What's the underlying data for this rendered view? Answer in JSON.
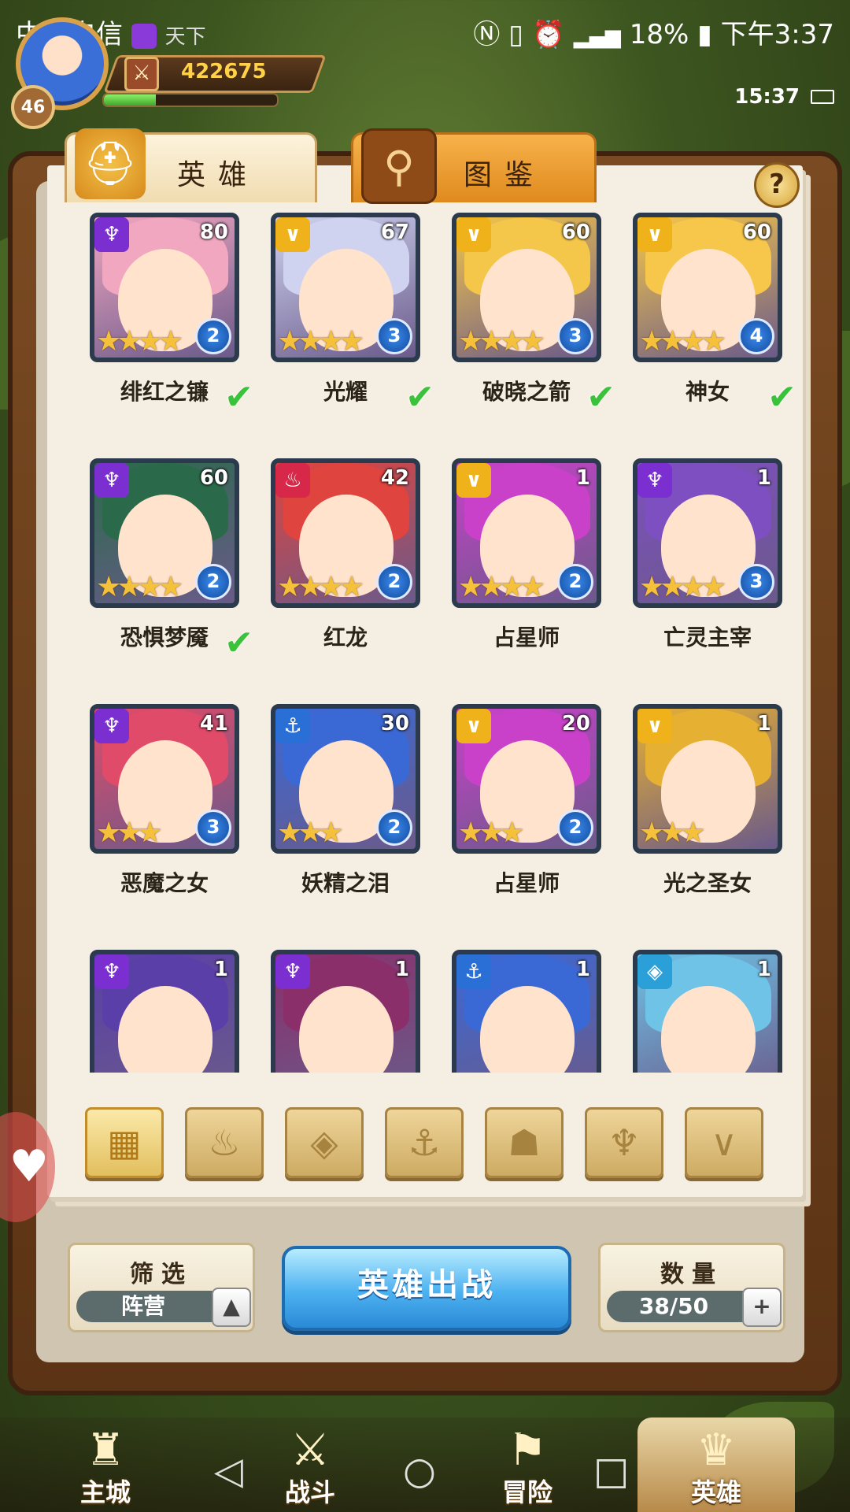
{
  "status_bar": {
    "carrier": "中国电信",
    "notification_text": "天下",
    "battery": "18%",
    "time": "下午3:37"
  },
  "player": {
    "level": "46",
    "power": "422675",
    "xp_fraction": 0.3,
    "game_clock": "15:37"
  },
  "tabs": [
    {
      "label": "英雄",
      "active": true
    },
    {
      "label": "图鉴",
      "active": false
    }
  ],
  "help_label": "?",
  "heroes": [
    {
      "name": "绯红之镰",
      "level": "80",
      "stars": 4,
      "rank": "2",
      "ready": true,
      "faction": "dark"
    },
    {
      "name": "光耀",
      "level": "67",
      "stars": 4,
      "rank": "3",
      "ready": true,
      "faction": "light"
    },
    {
      "name": "破晓之箭",
      "level": "60",
      "stars": 4,
      "rank": "3",
      "ready": true,
      "faction": "light"
    },
    {
      "name": "神女",
      "level": "60",
      "stars": 4,
      "rank": "4",
      "ready": true,
      "faction": "light"
    },
    {
      "name": "恐惧梦魇",
      "level": "60",
      "stars": 4,
      "rank": "2",
      "ready": true,
      "faction": "dark"
    },
    {
      "name": "红龙",
      "level": "42",
      "stars": 4,
      "rank": "2",
      "ready": false,
      "faction": "fire"
    },
    {
      "name": "占星师",
      "level": "1",
      "stars": 4,
      "rank": "2",
      "ready": false,
      "faction": "light"
    },
    {
      "name": "亡灵主宰",
      "level": "1",
      "stars": 4,
      "rank": "3",
      "ready": false,
      "faction": "dark"
    },
    {
      "name": "恶魔之女",
      "level": "41",
      "stars": 3,
      "rank": "3",
      "ready": false,
      "faction": "dark"
    },
    {
      "name": "妖精之泪",
      "level": "30",
      "stars": 3,
      "rank": "2",
      "ready": false,
      "faction": "water"
    },
    {
      "name": "占星师",
      "level": "20",
      "stars": 3,
      "rank": "2",
      "ready": false,
      "faction": "light"
    },
    {
      "name": "光之圣女",
      "level": "1",
      "stars": 3,
      "rank": "",
      "ready": false,
      "faction": "light"
    },
    {
      "name": "",
      "level": "1",
      "stars": 0,
      "rank": "",
      "ready": false,
      "faction": "dark"
    },
    {
      "name": "",
      "level": "1",
      "stars": 0,
      "rank": "",
      "ready": false,
      "faction": "dark"
    },
    {
      "name": "",
      "level": "1",
      "stars": 0,
      "rank": "",
      "ready": false,
      "faction": "water"
    },
    {
      "name": "",
      "level": "1",
      "stars": 0,
      "rank": "",
      "ready": false,
      "faction": "nature"
    }
  ],
  "faction_colors": {
    "dark": "#7b2fd0",
    "light": "#f0b21a",
    "fire": "#d8284a",
    "water": "#2a6fd6",
    "nature": "#2a9fd8"
  },
  "hair_colors": [
    "#f2a7c1",
    "#cfd3f0",
    "#f4c64a",
    "#f6c74a",
    "#2a6a4a",
    "#e0443e",
    "#c941c9",
    "#7e4fc0",
    "#e14b6a",
    "#3a69d6",
    "#c941c9",
    "#e6b033",
    "#5a3fa8",
    "#8a2f6a",
    "#3a69d6",
    "#6fc3e6"
  ],
  "filters": [
    {
      "icon": "grid-icon",
      "glyph": "▦",
      "active": true
    },
    {
      "icon": "fire-faction-icon",
      "glyph": "♨",
      "active": false
    },
    {
      "icon": "nature-faction-icon",
      "glyph": "◈",
      "active": false
    },
    {
      "icon": "anchor-faction-icon",
      "glyph": "⚓",
      "active": false
    },
    {
      "icon": "beast-faction-icon",
      "glyph": "☗",
      "active": false
    },
    {
      "icon": "dark-faction-icon",
      "glyph": "♆",
      "active": false
    },
    {
      "icon": "light-faction-icon",
      "glyph": "∨",
      "active": false
    }
  ],
  "controls": {
    "filter_title": "筛选",
    "filter_value": "阵营",
    "deploy_label": "英雄出战",
    "count_title": "数量",
    "count_value": "38/50"
  },
  "bottom_nav": [
    {
      "label": "主城",
      "icon": "castle-icon",
      "glyph": "♜",
      "active": false
    },
    {
      "label": "战斗",
      "icon": "swords-icon",
      "glyph": "⚔",
      "active": false
    },
    {
      "label": "冒险",
      "icon": "adventure-icon",
      "glyph": "⚑",
      "active": false
    },
    {
      "label": "英雄",
      "icon": "hero-crown-icon",
      "glyph": "♛",
      "active": true
    }
  ]
}
